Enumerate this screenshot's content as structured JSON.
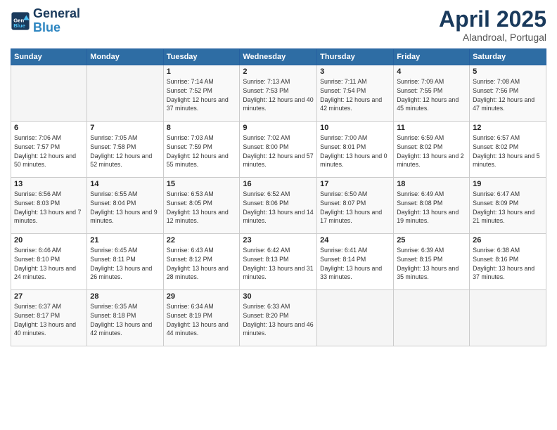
{
  "header": {
    "logo_line1": "General",
    "logo_line2": "Blue",
    "month": "April 2025",
    "location": "Alandroal, Portugal"
  },
  "weekdays": [
    "Sunday",
    "Monday",
    "Tuesday",
    "Wednesday",
    "Thursday",
    "Friday",
    "Saturday"
  ],
  "weeks": [
    [
      {
        "day": "",
        "info": ""
      },
      {
        "day": "",
        "info": ""
      },
      {
        "day": "1",
        "info": "Sunrise: 7:14 AM\nSunset: 7:52 PM\nDaylight: 12 hours and 37 minutes."
      },
      {
        "day": "2",
        "info": "Sunrise: 7:13 AM\nSunset: 7:53 PM\nDaylight: 12 hours and 40 minutes."
      },
      {
        "day": "3",
        "info": "Sunrise: 7:11 AM\nSunset: 7:54 PM\nDaylight: 12 hours and 42 minutes."
      },
      {
        "day": "4",
        "info": "Sunrise: 7:09 AM\nSunset: 7:55 PM\nDaylight: 12 hours and 45 minutes."
      },
      {
        "day": "5",
        "info": "Sunrise: 7:08 AM\nSunset: 7:56 PM\nDaylight: 12 hours and 47 minutes."
      }
    ],
    [
      {
        "day": "6",
        "info": "Sunrise: 7:06 AM\nSunset: 7:57 PM\nDaylight: 12 hours and 50 minutes."
      },
      {
        "day": "7",
        "info": "Sunrise: 7:05 AM\nSunset: 7:58 PM\nDaylight: 12 hours and 52 minutes."
      },
      {
        "day": "8",
        "info": "Sunrise: 7:03 AM\nSunset: 7:59 PM\nDaylight: 12 hours and 55 minutes."
      },
      {
        "day": "9",
        "info": "Sunrise: 7:02 AM\nSunset: 8:00 PM\nDaylight: 12 hours and 57 minutes."
      },
      {
        "day": "10",
        "info": "Sunrise: 7:00 AM\nSunset: 8:01 PM\nDaylight: 13 hours and 0 minutes."
      },
      {
        "day": "11",
        "info": "Sunrise: 6:59 AM\nSunset: 8:02 PM\nDaylight: 13 hours and 2 minutes."
      },
      {
        "day": "12",
        "info": "Sunrise: 6:57 AM\nSunset: 8:02 PM\nDaylight: 13 hours and 5 minutes."
      }
    ],
    [
      {
        "day": "13",
        "info": "Sunrise: 6:56 AM\nSunset: 8:03 PM\nDaylight: 13 hours and 7 minutes."
      },
      {
        "day": "14",
        "info": "Sunrise: 6:55 AM\nSunset: 8:04 PM\nDaylight: 13 hours and 9 minutes."
      },
      {
        "day": "15",
        "info": "Sunrise: 6:53 AM\nSunset: 8:05 PM\nDaylight: 13 hours and 12 minutes."
      },
      {
        "day": "16",
        "info": "Sunrise: 6:52 AM\nSunset: 8:06 PM\nDaylight: 13 hours and 14 minutes."
      },
      {
        "day": "17",
        "info": "Sunrise: 6:50 AM\nSunset: 8:07 PM\nDaylight: 13 hours and 17 minutes."
      },
      {
        "day": "18",
        "info": "Sunrise: 6:49 AM\nSunset: 8:08 PM\nDaylight: 13 hours and 19 minutes."
      },
      {
        "day": "19",
        "info": "Sunrise: 6:47 AM\nSunset: 8:09 PM\nDaylight: 13 hours and 21 minutes."
      }
    ],
    [
      {
        "day": "20",
        "info": "Sunrise: 6:46 AM\nSunset: 8:10 PM\nDaylight: 13 hours and 24 minutes."
      },
      {
        "day": "21",
        "info": "Sunrise: 6:45 AM\nSunset: 8:11 PM\nDaylight: 13 hours and 26 minutes."
      },
      {
        "day": "22",
        "info": "Sunrise: 6:43 AM\nSunset: 8:12 PM\nDaylight: 13 hours and 28 minutes."
      },
      {
        "day": "23",
        "info": "Sunrise: 6:42 AM\nSunset: 8:13 PM\nDaylight: 13 hours and 31 minutes."
      },
      {
        "day": "24",
        "info": "Sunrise: 6:41 AM\nSunset: 8:14 PM\nDaylight: 13 hours and 33 minutes."
      },
      {
        "day": "25",
        "info": "Sunrise: 6:39 AM\nSunset: 8:15 PM\nDaylight: 13 hours and 35 minutes."
      },
      {
        "day": "26",
        "info": "Sunrise: 6:38 AM\nSunset: 8:16 PM\nDaylight: 13 hours and 37 minutes."
      }
    ],
    [
      {
        "day": "27",
        "info": "Sunrise: 6:37 AM\nSunset: 8:17 PM\nDaylight: 13 hours and 40 minutes."
      },
      {
        "day": "28",
        "info": "Sunrise: 6:35 AM\nSunset: 8:18 PM\nDaylight: 13 hours and 42 minutes."
      },
      {
        "day": "29",
        "info": "Sunrise: 6:34 AM\nSunset: 8:19 PM\nDaylight: 13 hours and 44 minutes."
      },
      {
        "day": "30",
        "info": "Sunrise: 6:33 AM\nSunset: 8:20 PM\nDaylight: 13 hours and 46 minutes."
      },
      {
        "day": "",
        "info": ""
      },
      {
        "day": "",
        "info": ""
      },
      {
        "day": "",
        "info": ""
      }
    ]
  ]
}
